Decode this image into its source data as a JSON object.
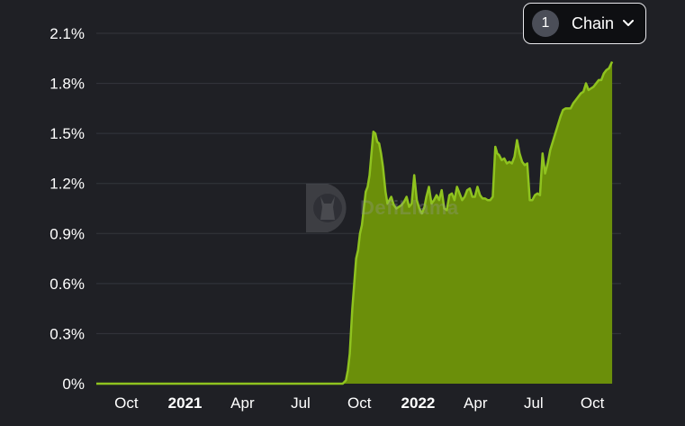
{
  "selector": {
    "count": "1",
    "label": "Chain",
    "icon": "chevron-down-icon"
  },
  "watermark": {
    "text": "DefiLlama"
  },
  "colors": {
    "fill": "#6b8f0a",
    "line": "#8fc31f",
    "background": "#1f2025"
  },
  "chart_data": {
    "type": "area",
    "title": "",
    "xlabel": "",
    "ylabel": "",
    "ylim": [
      0,
      2.1
    ],
    "xlim": [
      "2020-08-15",
      "2022-11-15"
    ],
    "grid": true,
    "y_ticks": [
      {
        "value": 0,
        "label": "0%"
      },
      {
        "value": 0.3,
        "label": "0.3%"
      },
      {
        "value": 0.6,
        "label": "0.6%"
      },
      {
        "value": 0.9,
        "label": "0.9%"
      },
      {
        "value": 1.2,
        "label": "1.2%"
      },
      {
        "value": 1.5,
        "label": "1.5%"
      },
      {
        "value": 1.8,
        "label": "1.8%"
      },
      {
        "value": 2.1,
        "label": "2.1%"
      }
    ],
    "x_ticks": [
      {
        "date": "2020-10-01",
        "label": "Oct",
        "bold": false
      },
      {
        "date": "2021-01-01",
        "label": "2021",
        "bold": true
      },
      {
        "date": "2021-04-01",
        "label": "Apr",
        "bold": false
      },
      {
        "date": "2021-07-01",
        "label": "Jul",
        "bold": false
      },
      {
        "date": "2021-10-01",
        "label": "Oct",
        "bold": false
      },
      {
        "date": "2022-01-01",
        "label": "2022",
        "bold": true
      },
      {
        "date": "2022-04-01",
        "label": "Apr",
        "bold": false
      },
      {
        "date": "2022-07-01",
        "label": "Jul",
        "bold": false
      },
      {
        "date": "2022-10-01",
        "label": "Oct",
        "bold": false
      }
    ],
    "series": [
      {
        "x": [
          "2020-08-15",
          "2021-08-01",
          "2021-09-05",
          "2021-09-10",
          "2021-09-13",
          "2021-09-16",
          "2021-09-20",
          "2021-09-23",
          "2021-09-26",
          "2021-09-29",
          "2021-10-02",
          "2021-10-05",
          "2021-10-08",
          "2021-10-11",
          "2021-10-14",
          "2021-10-17",
          "2021-10-20",
          "2021-10-23",
          "2021-10-26",
          "2021-10-29",
          "2021-11-01",
          "2021-11-04",
          "2021-11-07",
          "2021-11-11",
          "2021-11-14",
          "2021-11-17",
          "2021-11-20",
          "2021-11-24",
          "2021-11-28",
          "2021-12-02",
          "2021-12-06",
          "2021-12-10",
          "2021-12-14",
          "2021-12-18",
          "2021-12-22",
          "2021-12-26",
          "2021-12-30",
          "2022-01-03",
          "2022-01-07",
          "2022-01-11",
          "2022-01-14",
          "2022-01-18",
          "2022-01-22",
          "2022-01-26",
          "2022-01-30",
          "2022-02-03",
          "2022-02-07",
          "2022-02-11",
          "2022-02-15",
          "2022-02-19",
          "2022-02-23",
          "2022-02-27",
          "2022-03-03",
          "2022-03-07",
          "2022-03-11",
          "2022-03-15",
          "2022-03-19",
          "2022-03-23",
          "2022-03-27",
          "2022-03-31",
          "2022-04-04",
          "2022-04-08",
          "2022-04-12",
          "2022-04-16",
          "2022-04-20",
          "2022-04-24",
          "2022-04-28",
          "2022-05-02",
          "2022-05-05",
          "2022-05-08",
          "2022-05-12",
          "2022-05-16",
          "2022-05-20",
          "2022-05-24",
          "2022-05-28",
          "2022-06-01",
          "2022-06-05",
          "2022-06-09",
          "2022-06-13",
          "2022-06-17",
          "2022-06-21",
          "2022-06-25",
          "2022-06-29",
          "2022-07-03",
          "2022-07-07",
          "2022-07-11",
          "2022-07-15",
          "2022-07-19",
          "2022-07-23",
          "2022-07-27",
          "2022-07-31",
          "2022-08-04",
          "2022-08-08",
          "2022-08-12",
          "2022-08-16",
          "2022-08-20",
          "2022-08-24",
          "2022-08-28",
          "2022-09-01",
          "2022-09-05",
          "2022-09-09",
          "2022-09-13",
          "2022-09-17",
          "2022-09-21",
          "2022-09-25",
          "2022-09-29",
          "2022-10-03",
          "2022-10-07",
          "2022-10-11",
          "2022-10-15",
          "2022-10-19",
          "2022-10-23",
          "2022-10-27",
          "2022-11-01"
        ],
        "values": [
          0,
          0,
          0,
          0.02,
          0.08,
          0.18,
          0.45,
          0.6,
          0.75,
          0.8,
          0.9,
          0.95,
          1.05,
          1.15,
          1.18,
          1.25,
          1.38,
          1.51,
          1.5,
          1.45,
          1.44,
          1.38,
          1.3,
          1.15,
          1.08,
          1.1,
          1.12,
          1.07,
          1.05,
          1.06,
          1.07,
          1.09,
          1.12,
          1.06,
          1.08,
          1.25,
          1.1,
          1.05,
          1.02,
          1.06,
          1.12,
          1.18,
          1.08,
          1.1,
          1.13,
          1.1,
          1.16,
          1.05,
          1.04,
          1.13,
          1.14,
          1.1,
          1.18,
          1.14,
          1.1,
          1.12,
          1.16,
          1.17,
          1.12,
          1.12,
          1.18,
          1.13,
          1.11,
          1.11,
          1.1,
          1.1,
          1.12,
          1.42,
          1.38,
          1.37,
          1.34,
          1.35,
          1.32,
          1.33,
          1.32,
          1.36,
          1.46,
          1.38,
          1.33,
          1.31,
          1.32,
          1.1,
          1.1,
          1.13,
          1.14,
          1.13,
          1.38,
          1.26,
          1.32,
          1.4,
          1.45,
          1.5,
          1.55,
          1.6,
          1.64,
          1.65,
          1.65,
          1.65,
          1.68,
          1.7,
          1.72,
          1.74,
          1.75,
          1.8,
          1.76,
          1.77,
          1.78,
          1.8,
          1.82,
          1.82,
          1.86,
          1.88,
          1.89,
          1.93
        ]
      }
    ]
  }
}
